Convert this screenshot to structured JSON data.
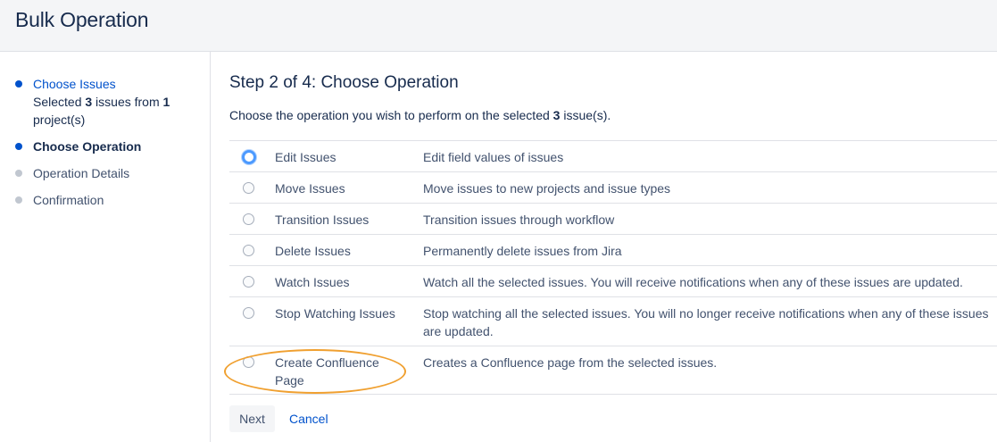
{
  "page": {
    "title": "Bulk Operation"
  },
  "sidebar": {
    "steps": [
      {
        "label": "Choose Issues",
        "summary": {
          "prefix": "Selected ",
          "issues": "3",
          "middle": " issues from ",
          "projects": "1",
          "suffix": "project(s)"
        }
      },
      {
        "label": "Choose Operation"
      },
      {
        "label": "Operation Details"
      },
      {
        "label": "Confirmation"
      }
    ]
  },
  "main": {
    "heading": "Step 2 of 4: Choose Operation",
    "intro": {
      "prefix": "Choose the operation you wish to perform on the selected ",
      "count": "3",
      "suffix": " issue(s)."
    },
    "operations": [
      {
        "name": "Edit Issues",
        "description": "Edit field values of issues"
      },
      {
        "name": "Move Issues",
        "description": "Move issues to new projects and issue types"
      },
      {
        "name": "Transition Issues",
        "description": "Transition issues through workflow"
      },
      {
        "name": "Delete Issues",
        "description": "Permanently delete issues from Jira"
      },
      {
        "name": "Watch Issues",
        "description": "Watch all the selected issues. You will receive notifications when any of these issues are updated."
      },
      {
        "name": "Stop Watching Issues",
        "description": "Stop watching all the selected issues. You will no longer receive notifications when any of these issues are updated."
      },
      {
        "name": "Create Confluence Page",
        "description": "Creates a Confluence page from the selected issues."
      }
    ],
    "next_label": "Next",
    "cancel_label": "Cancel"
  },
  "colors": {
    "link": "#0052cc",
    "highlight": "#f0a030",
    "focus": "#4c9aff"
  }
}
